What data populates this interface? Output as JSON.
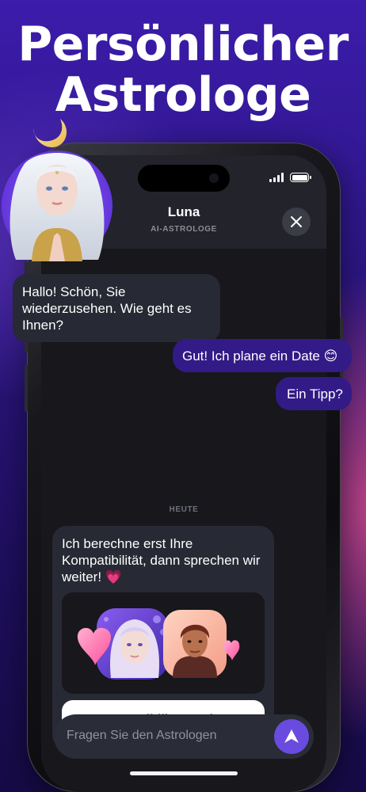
{
  "headline": {
    "line1": "Persönlicher",
    "line2": "Astrologe"
  },
  "header": {
    "name": "Luna",
    "subtitle": "AI-ASTROLOGE"
  },
  "messages": {
    "incoming_1": "Hallo! Schön, Sie wiederzusehen. Wie geht es Ihnen?",
    "outgoing_1": "Gut! Ich plane ein Date 😊",
    "outgoing_2": "Ein Tipp?",
    "day_label": "HEUTE",
    "incoming_2": "Ich berechne erst Ihre Kompatibilität, dann sprechen wir weiter! 💗"
  },
  "card": {
    "button_label": "Kompatibilität Prüfen"
  },
  "composer": {
    "placeholder": "Fragen Sie den Astrologen"
  },
  "colors": {
    "background_top": "#3b1cab",
    "accent": "#6a4be0",
    "outgoing_bubble": "#321b86",
    "incoming_bubble": "#272934",
    "chat_background": "#17171c"
  },
  "icons": [
    "close-icon",
    "send-icon",
    "signal-icon",
    "battery-icon",
    "heart-icon"
  ]
}
